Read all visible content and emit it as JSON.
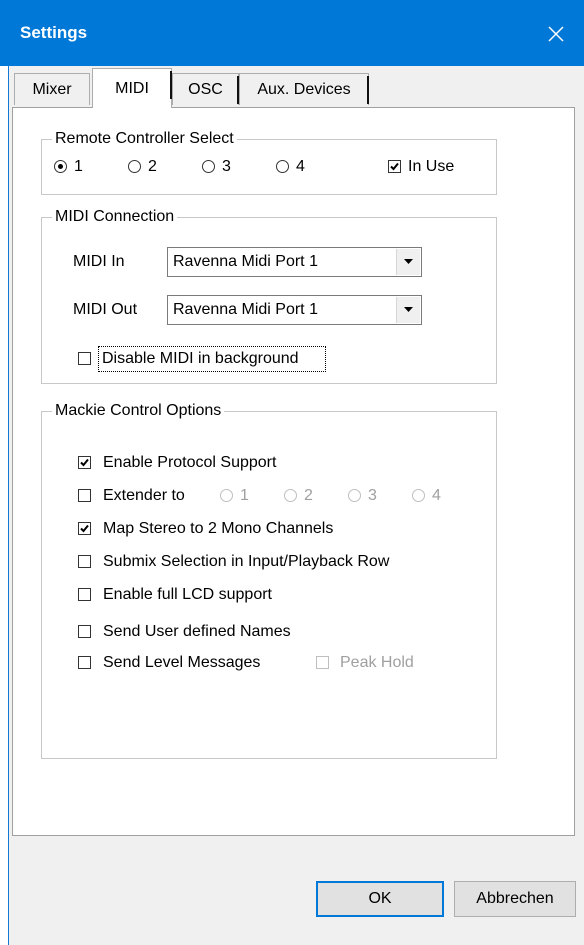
{
  "window": {
    "title": "Settings"
  },
  "tabs": [
    {
      "label": "Mixer",
      "active": false
    },
    {
      "label": "MIDI",
      "active": true
    },
    {
      "label": "OSC",
      "active": false
    },
    {
      "label": "Aux. Devices",
      "active": false
    }
  ],
  "remote_controller": {
    "legend": "Remote Controller Select",
    "options": [
      "1",
      "2",
      "3",
      "4"
    ],
    "selected": "1",
    "in_use_label": "In Use",
    "in_use_checked": true
  },
  "midi_connection": {
    "legend": "MIDI Connection",
    "midi_in_label": "MIDI In",
    "midi_in_value": "Ravenna Midi Port 1",
    "midi_out_label": "MIDI Out",
    "midi_out_value": "Ravenna Midi Port 1",
    "disable_bg_label": "Disable MIDI in background",
    "disable_bg_checked": false
  },
  "mackie": {
    "legend": "Mackie Control Options",
    "enable_protocol_label": "Enable Protocol Support",
    "enable_protocol_checked": true,
    "extender_label": "Extender to",
    "extender_checked": false,
    "extender_options": [
      "1",
      "2",
      "3",
      "4"
    ],
    "map_stereo_label": "Map Stereo to 2 Mono Channels",
    "map_stereo_checked": true,
    "submix_label": "Submix Selection in Input/Playback Row",
    "submix_checked": false,
    "lcd_label": "Enable full LCD support",
    "lcd_checked": false,
    "user_names_label": "Send User defined Names",
    "user_names_checked": false,
    "level_messages_label": "Send Level Messages",
    "level_messages_checked": false,
    "peak_hold_label": "Peak Hold",
    "peak_hold_checked": false
  },
  "buttons": {
    "ok": "OK",
    "cancel": "Abbrechen"
  },
  "colors": {
    "titlebar": "#0078d7",
    "dialog_bg": "#f0f0f0",
    "panel_bg": "#ffffff"
  }
}
